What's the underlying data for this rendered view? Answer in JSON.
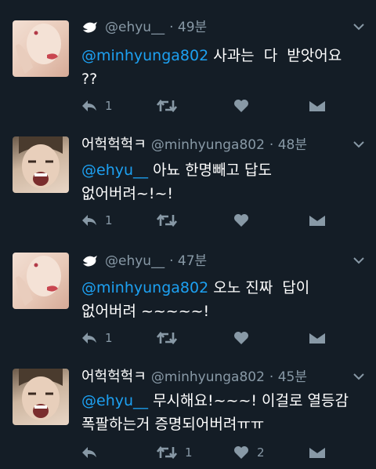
{
  "tweets": [
    {
      "display_name": "",
      "handle": "@ehyu__",
      "time": "· 49분",
      "mention": "@minhyunga802",
      "text": " 사과는  다  받앗어요\n??",
      "reply_count": "1",
      "retweet_count": "",
      "like_count": "",
      "avatar_icon": "girl-avatar"
    },
    {
      "display_name": "어헉헉헉ㅋ",
      "handle": "@minhyunga802",
      "time": "· 48분",
      "mention": "@ehyu__",
      "text": " 아뇨 한명빼고 답도\n없어버려~!~!",
      "reply_count": "1",
      "retweet_count": "",
      "like_count": "",
      "avatar_icon": "boy-avatar"
    },
    {
      "display_name": "",
      "handle": "@ehyu__",
      "time": "· 47분",
      "mention": "@minhyunga802",
      "text": " 오노 진짜  답이\n없어버려 ~~~~~!",
      "reply_count": "1",
      "retweet_count": "",
      "like_count": "",
      "avatar_icon": "girl-avatar"
    },
    {
      "display_name": "어헉헉헉ㅋ",
      "handle": "@minhyunga802",
      "time": "· 45분",
      "mention": "@ehyu__",
      "text": " 무시해요!~~~! 이걸로 열등감\n폭팔하는거 증명되어버려ㅠㅠ",
      "reply_count": "",
      "retweet_count": "1",
      "like_count": "2",
      "avatar_icon": "boy-avatar"
    }
  ],
  "colors": {
    "background": "#141d26",
    "muted": "#8899a6",
    "mention": "#1da1f2",
    "text": "#ffffff"
  }
}
